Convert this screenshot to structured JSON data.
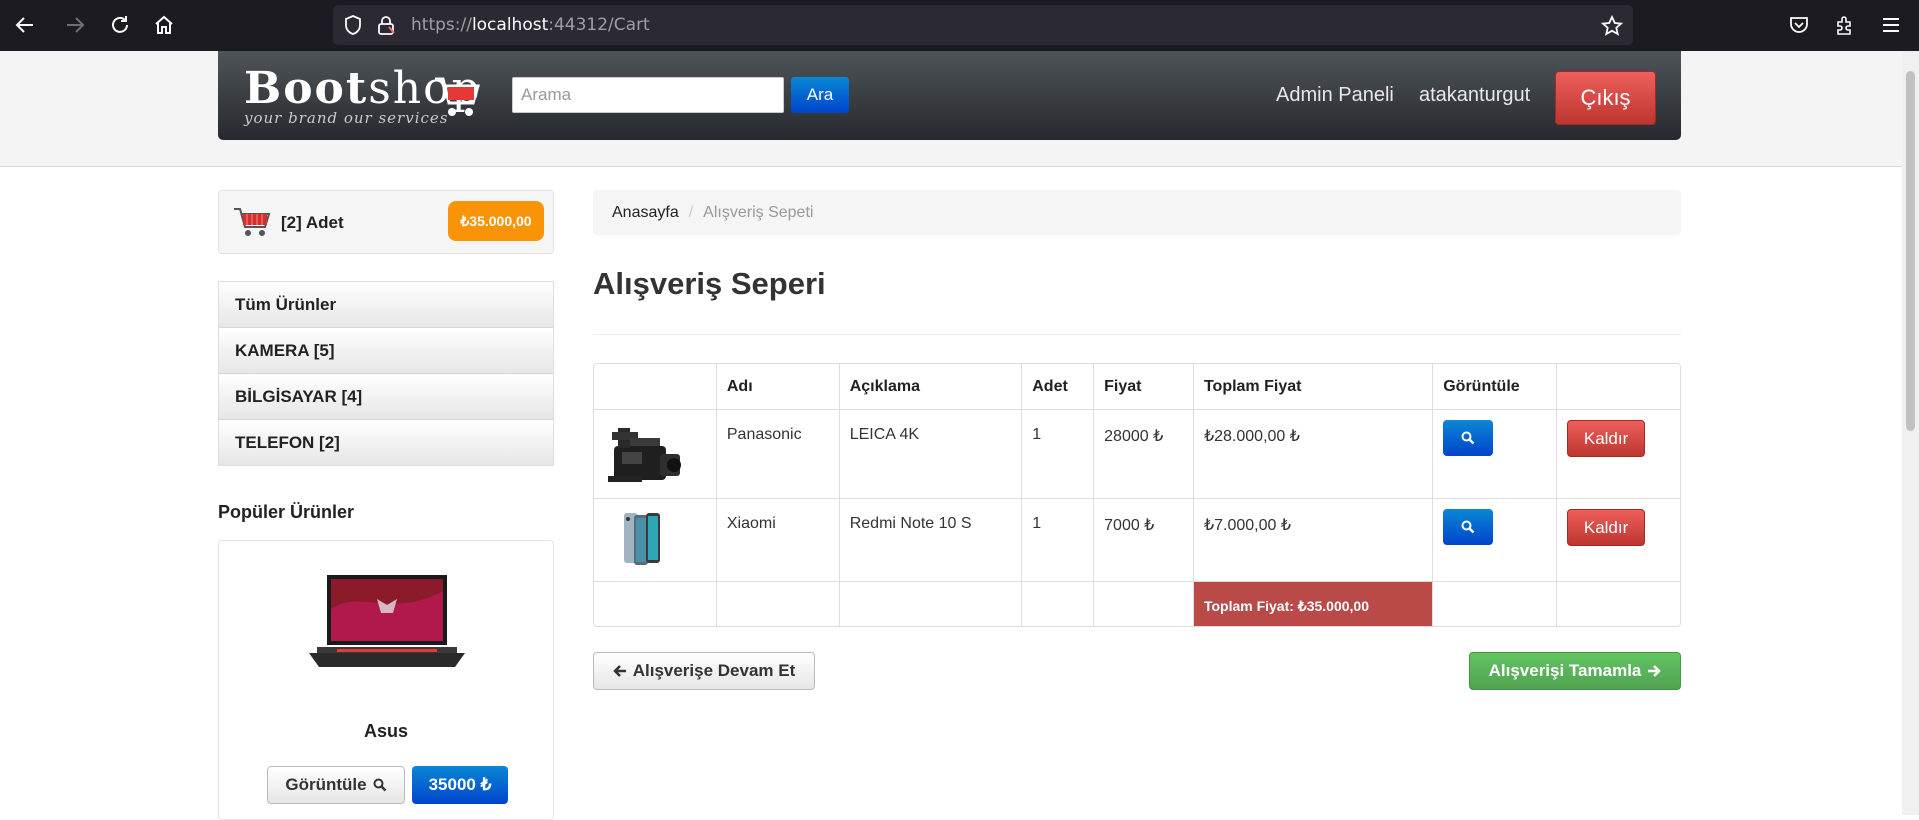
{
  "browser": {
    "url_prefix": "https://",
    "url_host": "localhost",
    "url_rest": ":44312/Cart"
  },
  "header": {
    "logo_text_bold": "Boot",
    "logo_text_thin": "shop",
    "logo_tagline": "your brand our services",
    "search_placeholder": "Arama",
    "search_button": "Ara",
    "admin_link": "Admin Paneli",
    "username": "atakanturgut",
    "logout_button": "Çıkış"
  },
  "sidebar": {
    "cart_count": "[2] Adet",
    "cart_total": "₺35.000,00",
    "categories": [
      {
        "label": "Tüm Ürünler"
      },
      {
        "label": "KAMERA [5]"
      },
      {
        "label": "BİLGİSAYAR [4]"
      },
      {
        "label": "TELEFON [2]"
      }
    ],
    "popular_heading": "Popüler Ürünler",
    "popular_product": {
      "name": "Asus",
      "view_button": "Görüntüle",
      "price_button": "35000 ₺"
    }
  },
  "main": {
    "breadcrumb": [
      {
        "label": "Anasayfa"
      },
      {
        "label": "Alışveriş Sepeti"
      }
    ],
    "breadcrumb_separator": "/",
    "title": "Alışveriş Seperi",
    "table": {
      "headers": [
        "",
        "Adı",
        "Açıklama",
        "Adet",
        "Fiyat",
        "Toplam Fiyat",
        "Görüntüle",
        ""
      ],
      "rows": [
        {
          "name": "Panasonic",
          "description": "LEICA 4K",
          "qty": "1",
          "price": "28000 ₺",
          "total": "₺28.000,00 ₺",
          "remove": "Kaldır"
        },
        {
          "name": "Xiaomi",
          "description": "Redmi Note 10 S",
          "qty": "1",
          "price": "7000 ₺",
          "total": "₺7.000,00 ₺",
          "remove": "Kaldır"
        }
      ],
      "grand_total": "Toplam Fiyat: ₺35.000,00"
    },
    "continue_button": "Alışverişe Devam Et",
    "complete_button": "Alışverişi Tamamla"
  },
  "colors": {
    "navbar": "#262a2e",
    "primary_blue": "#0044cc",
    "danger_red": "#bd362f",
    "success_green": "#51a351",
    "warning_orange": "#f89406",
    "total_cell": "#b94a48"
  },
  "icons": [
    "back-icon",
    "forward-icon",
    "reload-icon",
    "home-icon",
    "shield-icon",
    "lock-icon",
    "star-icon",
    "pocket-icon",
    "extensions-icon",
    "menu-icon",
    "cart-logo-icon",
    "search-zoom-icon",
    "arrow-left-icon",
    "arrow-right-icon"
  ]
}
